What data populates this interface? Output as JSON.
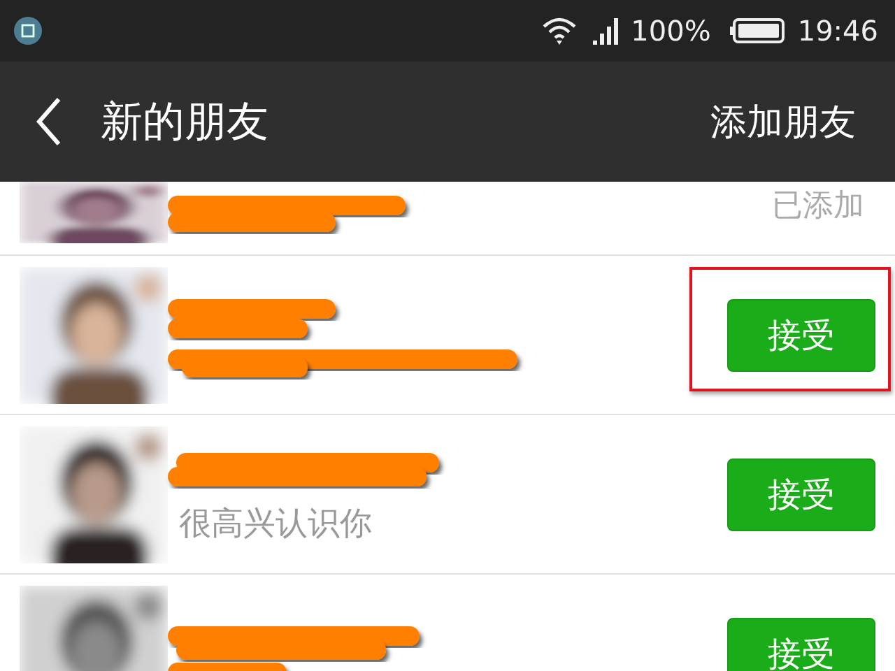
{
  "status_bar": {
    "battery": "100%",
    "time": "19:46"
  },
  "header": {
    "title": "新的朋友",
    "action": "添加朋友"
  },
  "rows": [
    {
      "action": {
        "kind": "added",
        "label": "已添加"
      },
      "highlighted": false
    },
    {
      "action": {
        "kind": "accept",
        "label": "接受"
      },
      "highlighted": true
    },
    {
      "message": "很高兴认识你",
      "action": {
        "kind": "accept",
        "label": "接受"
      },
      "highlighted": false
    },
    {
      "action": {
        "kind": "accept",
        "label": "接受"
      },
      "highlighted": false
    }
  ]
}
